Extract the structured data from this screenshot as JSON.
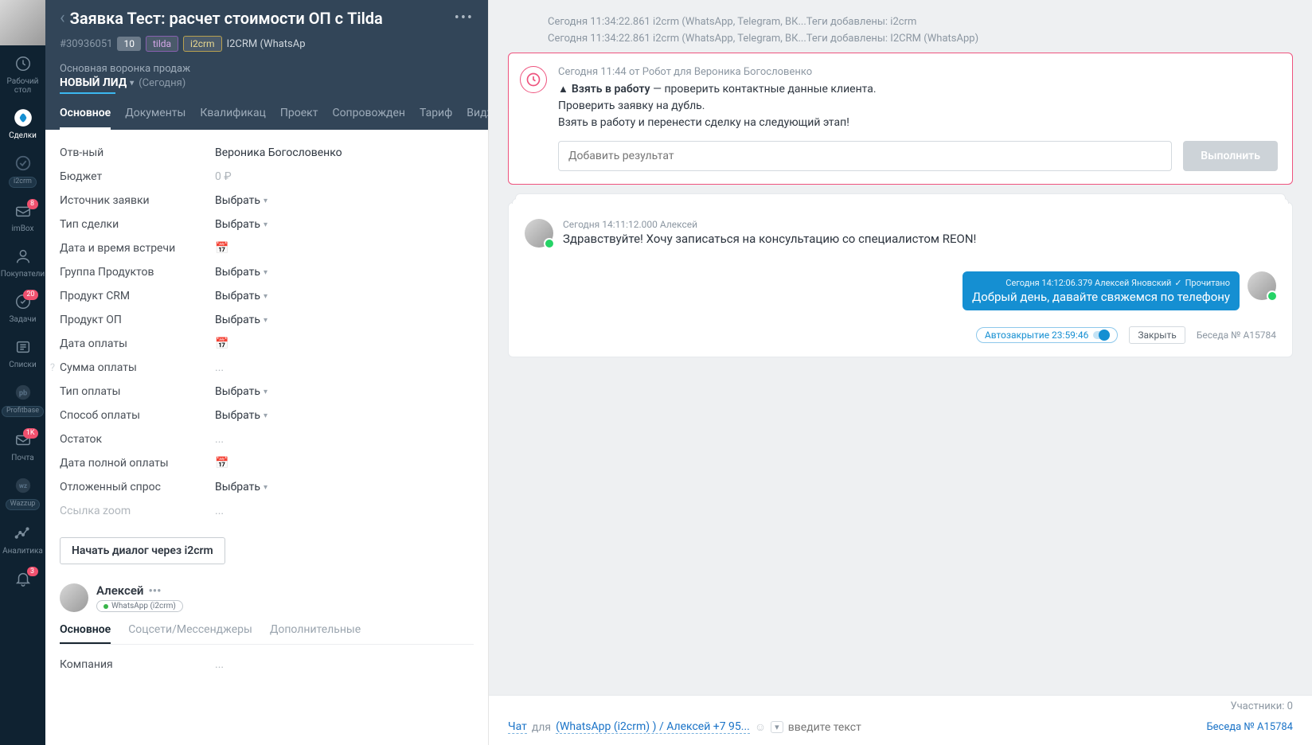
{
  "sidebar": {
    "items": [
      {
        "label": "Рабочий стол"
      },
      {
        "label": "Сделки"
      },
      {
        "label": "i2crm"
      },
      {
        "label": "imBox",
        "badge": "8"
      },
      {
        "label": "Покупатели"
      },
      {
        "label": "Задачи",
        "badge": "20"
      },
      {
        "label": "Списки"
      },
      {
        "label": "Profitbase"
      },
      {
        "label": "Почта",
        "badge": "1K"
      },
      {
        "label": "Wazzup"
      },
      {
        "label": "Аналитика"
      },
      {
        "label": "",
        "badge": "3"
      }
    ]
  },
  "deal": {
    "title": "Заявка Тест: расчет стоимости ОП с Tilda",
    "id": "#30936051",
    "tag_num": "10",
    "tag_tilda": "tilda",
    "tag_i2crm": "i2crm",
    "source": "I2CRM (WhatsAp",
    "pipeline": "Основная воронка продаж",
    "stage": "НОВЫЙ ЛИД",
    "stage_date": "(Сегодня)"
  },
  "tabs": [
    "Основное",
    "Документы",
    "Квалификац",
    "Проект",
    "Сопровожден",
    "Тариф",
    "Виджеты"
  ],
  "fields": {
    "responsible_label": "Отв-ный",
    "responsible_value": "Вероника Богословенко",
    "budget_label": "Бюджет",
    "budget_value": "0 ₽",
    "source_label": "Источник заявки",
    "select_placeholder": "Выбрать",
    "dealtype_label": "Тип сделки",
    "meeting_label": "Дата и время встречи",
    "group_label": "Группа Продуктов",
    "crm_label": "Продукт CRM",
    "op_label": "Продукт ОП",
    "paydate_label": "Дата оплаты",
    "paysum_label": "Сумма оплаты",
    "paytype_label": "Тип оплаты",
    "paymethod_label": "Способ оплаты",
    "rest_label": "Остаток",
    "fullpay_label": "Дата полной оплаты",
    "deferred_label": "Отложенный спрос",
    "zoom_label": "Ссылка zoom",
    "dots": "...",
    "start_dialog": "Начать диалог через i2crm"
  },
  "contact": {
    "name": "Алексей",
    "phone_tag": "WhatsApp (i2crm)",
    "tabs": [
      "Основное",
      "Соцсети/Мессенджеры",
      "Дополнительные"
    ],
    "company_label": "Компания",
    "company_value": "..."
  },
  "timeline": {
    "line1": "Сегодня 11:34:22.861 i2crm (WhatsApp, Telegram, ВК...Теги добавлены: i2crm",
    "line2": "Сегодня 11:34:22.861 i2crm (WhatsApp, Telegram, ВК...Теги добавлены: I2CRM (WhatsApp)",
    "task_head": "Сегодня 11:44 от Робот для Вероника Богословенко",
    "task_title": "Взять в работу",
    "task_desc": " — проверить контактные данные клиента.",
    "task_l2": "Проверить заявку на дубль.",
    "task_l3": "Взять в работу и перенести сделку на следующий этап!",
    "task_result_ph": "Добавить результат",
    "task_btn": "Выполнить",
    "msg_in_head": "Сегодня 14:11:12.000 Алексей",
    "msg_in_text": "Здравствуйте! Хочу записаться на консультацию со специалистом REON!",
    "msg_out_head": "Сегодня 14:12:06.379 Алексей Яновский",
    "msg_out_status": "Прочитано",
    "msg_out_text": "Добрый день, давайте свяжемся по телефону",
    "autoclose": "Автозакрытие 23:59:46",
    "close": "Закрыть",
    "conv": "Беседа № A15784"
  },
  "footer": {
    "participants": "Участники: 0",
    "chat": "Чат",
    "for": "для",
    "channel": "(WhatsApp (i2crm) ) / Алексей +7 95...",
    "placeholder": "введите текст",
    "conv": "Беседа № A15784"
  }
}
